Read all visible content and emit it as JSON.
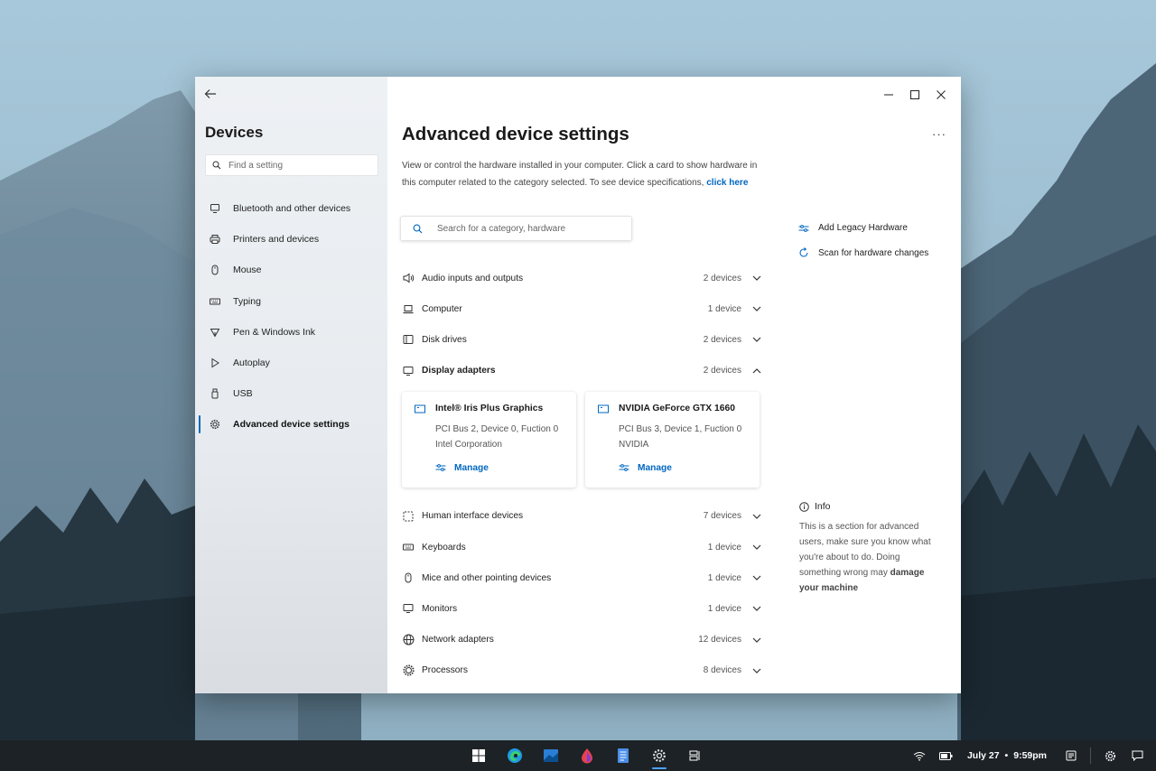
{
  "sidebar": {
    "title": "Devices",
    "search_placeholder": "Find a setting",
    "items": [
      {
        "label": "Bluetooth and other devices",
        "icon": "bluetooth-devices-icon"
      },
      {
        "label": "Printers and devices",
        "icon": "printer-icon"
      },
      {
        "label": "Mouse",
        "icon": "mouse-icon"
      },
      {
        "label": "Typing",
        "icon": "keyboard-icon"
      },
      {
        "label": "Pen & Windows Ink",
        "icon": "pen-icon"
      },
      {
        "label": "Autoplay",
        "icon": "play-icon"
      },
      {
        "label": "USB",
        "icon": "usb-icon"
      },
      {
        "label": "Advanced device settings",
        "icon": "gear-icon",
        "active": true
      }
    ]
  },
  "main": {
    "title": "Advanced device settings",
    "more_label": "···",
    "description": "View or control the hardware installed in your computer. Click a card to show hardware in this computer related to the category selected. To see device specifications,",
    "description_link": "click here",
    "search_placeholder": "Search for a category, hardware",
    "categories": [
      {
        "name": "Audio inputs and outputs",
        "count": "2 devices",
        "icon": "speaker-icon"
      },
      {
        "name": "Computer",
        "count": "1 device",
        "icon": "laptop-icon"
      },
      {
        "name": "Disk drives",
        "count": "2 devices",
        "icon": "disk-drive-icon"
      },
      {
        "name": "Display adapters",
        "count": "2 devices",
        "icon": "monitor-icon",
        "expanded": true
      },
      {
        "name": "Human interface devices",
        "count": "7 devices",
        "icon": "hid-icon"
      },
      {
        "name": "Keyboards",
        "count": "1 device",
        "icon": "keyboard-icon"
      },
      {
        "name": "Mice and other pointing devices",
        "count": "1 device",
        "icon": "mouse-icon"
      },
      {
        "name": "Monitors",
        "count": "1 device",
        "icon": "monitor-icon"
      },
      {
        "name": "Network adapters",
        "count": "12 devices",
        "icon": "globe-icon"
      },
      {
        "name": "Processors",
        "count": "8 devices",
        "icon": "processor-icon"
      }
    ],
    "cards": [
      {
        "title": "Intel® Iris Plus Graphics",
        "line1": "PCI Bus 2, Device 0, Fuction 0",
        "line2": "Intel Corporation",
        "action": "Manage"
      },
      {
        "title": "NVIDIA GeForce GTX 1660",
        "line1": "PCI Bus 3, Device 1, Fuction 0",
        "line2": "NVIDIA",
        "action": "Manage"
      }
    ],
    "side_actions": [
      {
        "label": "Add Legacy Hardware",
        "icon": "sliders-icon"
      },
      {
        "label": "Scan for hardware changes",
        "icon": "refresh-icon"
      }
    ],
    "info": {
      "title": "Info",
      "text": "This is a section for advanced users, make sure you know what you're about to do. Doing something wrong may",
      "text_bold": "damage your machine"
    }
  },
  "taskbar": {
    "date": "July 27",
    "separator": "•",
    "time": "9:59pm",
    "apps": [
      "windows-start-icon",
      "edge-icon",
      "mail-icon",
      "paint-drop-icon",
      "documents-icon",
      "settings-icon",
      "task-view-icon"
    ],
    "active_app": "settings-icon"
  },
  "colors": {
    "accent": "#0067c0",
    "taskbar": "#1d2226"
  }
}
